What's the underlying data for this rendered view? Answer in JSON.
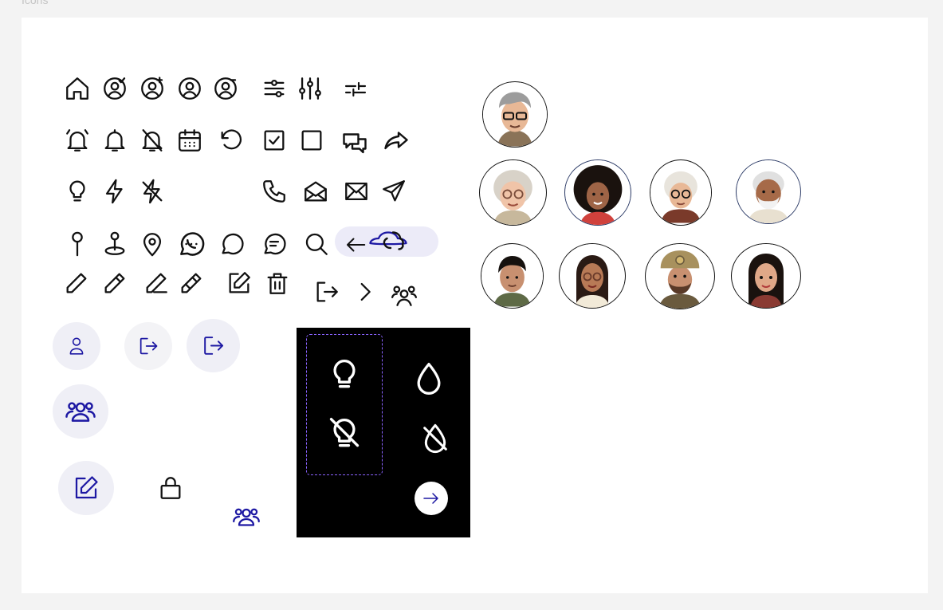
{
  "frame": {
    "label": "Icons"
  },
  "colors": {
    "icon_stroke": "#111111",
    "accent": "#1d18a3",
    "soft_circle": "#efeff6",
    "dark_panel": "#000000",
    "dashed_outline": "#8a63ff"
  },
  "icon_rows": [
    [
      "home-icon",
      "user-check-icon",
      "user-add-icon",
      "user-circle-icon",
      "user-remove-icon",
      "sliders-horizontal-icon",
      "sliders-vertical-icon",
      "sliders-compact-icon"
    ],
    [
      "alarm-bell-icon",
      "bell-icon",
      "bell-off-icon",
      "calendar-icon",
      "undo-icon",
      "checkbox-checked-icon",
      "checkbox-empty-icon",
      "chat-bubbles-icon",
      "share-arrow-icon"
    ],
    [
      "lightbulb-icon",
      "lightning-icon",
      "lightning-off-icon",
      "phone-icon",
      "mail-open-icon",
      "mail-icon",
      "send-icon"
    ],
    [
      "pin-icon",
      "location-pin-ground-icon",
      "map-pin-icon",
      "whatsapp-icon",
      "chat-bubble-icon",
      "chat-lines-icon",
      "search-icon",
      "arrow-left-icon"
    ],
    [
      "pencil-icon",
      "pencil-alt-icon",
      "pen-icon",
      "pen-lines-icon",
      "edit-square-icon",
      "trash-icon",
      "logout-icon",
      "chevron-right-icon",
      "users-group-icon"
    ]
  ],
  "avatars": [
    {
      "name": "avatar-man-glasses-gray-hair"
    },
    {
      "name": "avatar-older-woman-glasses"
    },
    {
      "name": "avatar-woman-curly-hair"
    },
    {
      "name": "avatar-elderly-woman-glasses"
    },
    {
      "name": "avatar-elderly-man-beard"
    },
    {
      "name": "avatar-young-boy"
    },
    {
      "name": "avatar-woman-glasses"
    },
    {
      "name": "avatar-firefighter-man"
    },
    {
      "name": "avatar-girl-long-hair"
    }
  ]
}
